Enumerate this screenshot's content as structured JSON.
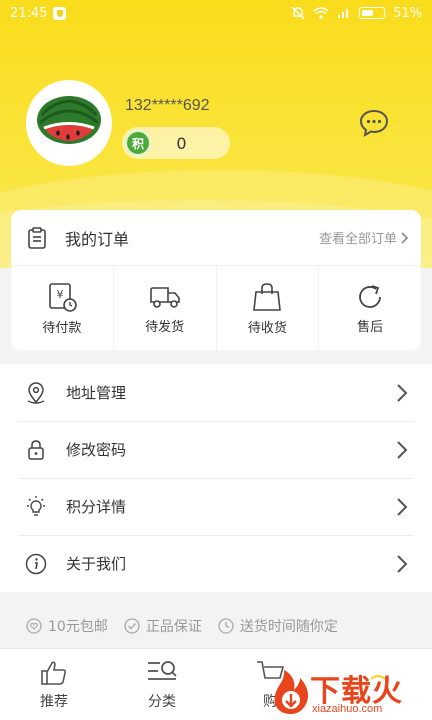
{
  "status_bar": {
    "time": "21:45",
    "battery": "51%"
  },
  "profile": {
    "phone": "132*****692",
    "points_badge": "积",
    "points": "0"
  },
  "orders": {
    "title": "我的订单",
    "view_all": "查看全部订单",
    "items": [
      {
        "label": "待付款",
        "icon": "payment-pending-icon"
      },
      {
        "label": "待发货",
        "icon": "truck-icon"
      },
      {
        "label": "待收货",
        "icon": "shopping-bag-icon"
      },
      {
        "label": "售后",
        "icon": "refresh-icon"
      }
    ]
  },
  "menu": [
    {
      "label": "地址管理",
      "icon": "location-pin-icon"
    },
    {
      "label": "修改密码",
      "icon": "lock-icon"
    },
    {
      "label": "积分详情",
      "icon": "lightbulb-icon"
    },
    {
      "label": "关于我们",
      "icon": "info-icon"
    }
  ],
  "guarantees": [
    "10元包邮",
    "正品保证",
    "送货时间随你定"
  ],
  "tabs": [
    {
      "label": "推荐",
      "icon": "thumbs-up-icon"
    },
    {
      "label": "分类",
      "icon": "category-search-icon"
    },
    {
      "label": "购",
      "icon": "cart-icon"
    }
  ],
  "watermark": {
    "text": "下载火",
    "sub": "xiazaihuo.com"
  },
  "colors": {
    "brand_yellow": "#f9dc1b",
    "points_green": "#4caa3a",
    "watermark_red": "#e8451d"
  }
}
